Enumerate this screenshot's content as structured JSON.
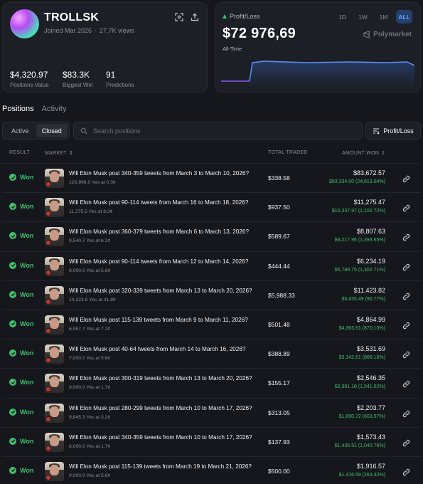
{
  "profile": {
    "username": "TROLLSK",
    "joined": "Joined Mar 2026",
    "views": "27.7K views",
    "stats": [
      {
        "value": "$4,320.97",
        "label": "Positions Value"
      },
      {
        "value": "$83.3K",
        "label": "Biggest Win"
      },
      {
        "value": "91",
        "label": "Predictions"
      }
    ]
  },
  "pnl": {
    "label": "Profit/Loss",
    "value": "$72 976,69",
    "period": "All-Time",
    "brand": "Polymarket",
    "ranges": [
      "1D",
      "1W",
      "1M",
      "ALL"
    ],
    "active_range": "ALL",
    "colors": {
      "before": "#8b5cf6",
      "after": "#5b8def"
    }
  },
  "tabs": {
    "positions": "Positions",
    "activity": "Activity"
  },
  "filters": {
    "active": "Active",
    "closed": "Closed",
    "search_placeholder": "Search positions",
    "sort_label": "Profit/Loss"
  },
  "table": {
    "headers": {
      "result": "RESULT",
      "market": "MARKET",
      "total_traded": "TOTAL TRADED",
      "amount_won": "AMOUNT WON"
    },
    "rows": [
      {
        "result": "Won",
        "title": "Will Elon Musk post 340-359 tweets from March 3 to March 10, 2026?",
        "sub": "126,998.0 Yes at 0.3¢",
        "traded": "$338.58",
        "amount": "$83,672.57",
        "gain": "$83,334.00 (24,613.04%)"
      },
      {
        "result": "Won",
        "title": "Will Elon Musk post 90-114 tweets from March 16 to March 18, 2026?",
        "sub": "11,275.5 Yes at 8.3¢",
        "traded": "$937.50",
        "amount": "$11,275.47",
        "gain": "$10,337.97 (1,102.72%)"
      },
      {
        "result": "Won",
        "title": "Will Elon Musk post 360-379 tweets from March 6 to March 13, 2026?",
        "sub": "9,540.7 Yes at 6.2¢",
        "traded": "$589.67",
        "amount": "$8,807.63",
        "gain": "$8,217.96 (1,393.65%)"
      },
      {
        "result": "Won",
        "title": "Will Elon Musk post 90-114 tweets from March 12 to March 14, 2026?",
        "sub": "8,000.0 Yes at 5.6¢",
        "traded": "$444.44",
        "amount": "$6,234.19",
        "gain": "$5,789.75 (1,302.71%)"
      },
      {
        "result": "Won",
        "title": "Will Elon Musk post 320-339 tweets from March 13 to March 20, 2026?",
        "sub": "14,323.6 Yes at 41.8¢",
        "traded": "$5,988.33",
        "amount": "$11,423.82",
        "gain": "$5,435.49 (90.77%)"
      },
      {
        "result": "Won",
        "title": "Will Elon Musk post 115-139 tweets from March 9 to March 11, 2026?",
        "sub": "6,957.7 Yes at 7.2¢",
        "traded": "$501.48",
        "amount": "$4,864.99",
        "gain": "$4,363.51 (870.13%)"
      },
      {
        "result": "Won",
        "title": "Will Elon Musk post 40-64 tweets from March 14 to March 16, 2026?",
        "sub": "7,000.0 Yes at 5.6¢",
        "traded": "$388.89",
        "amount": "$3,531.69",
        "gain": "$3,142.81 (808.16%)"
      },
      {
        "result": "Won",
        "title": "Will Elon Musk post 300-319 tweets from March 13 to March 20, 2026?",
        "sub": "9,000.0 Yes at 1.7¢",
        "traded": "$155.17",
        "amount": "$2,546.35",
        "gain": "$2,391.18 (1,541.02%)"
      },
      {
        "result": "Won",
        "title": "Will Elon Musk post 280-299 tweets from March 10 to March 17, 2026?",
        "sub": "9,845.3 Yes at 3.2¢",
        "traded": "$313.05",
        "amount": "$2,203.77",
        "gain": "$1,890.72 (603.97%)"
      },
      {
        "result": "Won",
        "title": "Will Elon Musk post 340-359 tweets from March 10 to March 17, 2026?",
        "sub": "8,000.0 Yes at 1.7¢",
        "traded": "$137.93",
        "amount": "$1,573.43",
        "gain": "$1,435.51 (1,040.76%)"
      },
      {
        "result": "Won",
        "title": "Will Elon Musk post 115-139 tweets from March 19 to March 21, 2026?",
        "sub": "9,000.0 Yes at 5.6¢",
        "traded": "$500.00",
        "amount": "$1,916.57",
        "gain": "$1,416.58 (283.32%)"
      }
    ]
  }
}
